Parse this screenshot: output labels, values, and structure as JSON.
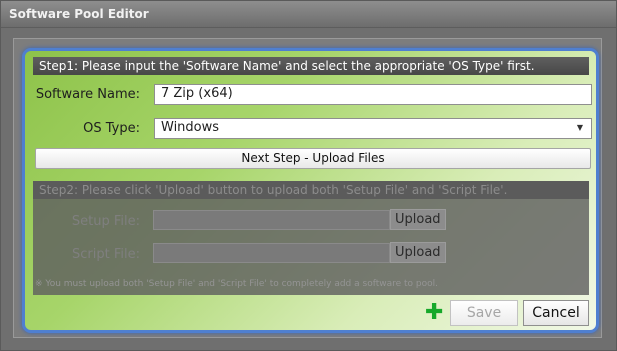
{
  "window": {
    "title": "Software Pool Editor"
  },
  "step1": {
    "header": "Step1: Please input the 'Software Name' and select the appropriate 'OS Type' first.",
    "software_name_label": "Software Name:",
    "software_name_value": "7 Zip (x64)",
    "os_type_label": "OS Type:",
    "os_type_value": "Windows",
    "next_step_label": "Next Step - Upload Files"
  },
  "step2": {
    "header": "Step2: Please click 'Upload' button to upload both 'Setup File' and 'Script File'.",
    "setup_file_label": "Setup File:",
    "setup_file_value": "",
    "script_file_label": "Script File:",
    "script_file_value": "",
    "upload_label": "Upload",
    "note": "※ You must upload both 'Setup File' and 'Script File' to completely add a software to pool."
  },
  "footer": {
    "add_icon": "plus-icon",
    "save_label": "Save",
    "cancel_label": "Cancel"
  },
  "colors": {
    "panel_border": "#4f7fd0",
    "panel_gradient_start": "#8ec34a",
    "add_icon": "#16a82a"
  }
}
